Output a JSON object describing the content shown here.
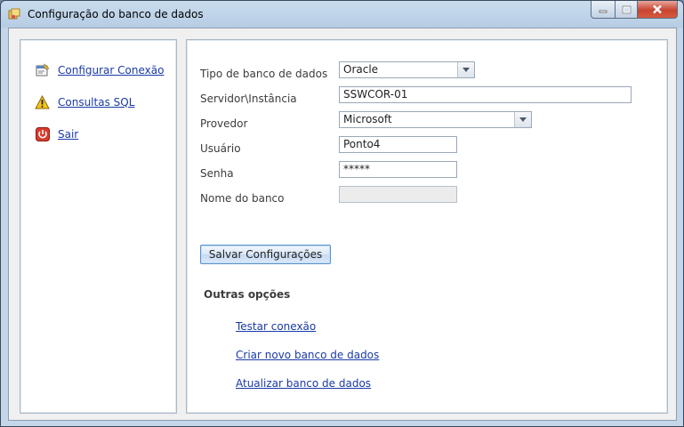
{
  "window": {
    "title": "Configuração do banco de dados"
  },
  "sidebar": {
    "items": [
      {
        "label": "Configurar Conexão",
        "icon": "settings-doc-icon"
      },
      {
        "label": "Consultas SQL",
        "icon": "warning-icon"
      },
      {
        "label": "Sair",
        "icon": "power-icon"
      }
    ]
  },
  "form": {
    "db_type": {
      "label": "Tipo de banco de dados",
      "value": "Oracle"
    },
    "server": {
      "label": "Servidor\\Instância",
      "value": "SSWCOR-01"
    },
    "provider": {
      "label": "Provedor",
      "value": "Microsoft"
    },
    "user": {
      "label": "Usuário",
      "value": "Ponto4"
    },
    "password": {
      "label": "Senha",
      "value": "*****"
    },
    "db_name": {
      "label": "Nome do banco",
      "value": ""
    },
    "save_label": "Salvar Configurações"
  },
  "other_options": {
    "heading": "Outras opções",
    "links": [
      "Testar conexão",
      "Criar novo banco de dados",
      "Atualizar banco de dados"
    ]
  },
  "colors": {
    "link": "#1a3aa8",
    "close_button": "#c8442f",
    "titlebar": "#c9dcef"
  }
}
